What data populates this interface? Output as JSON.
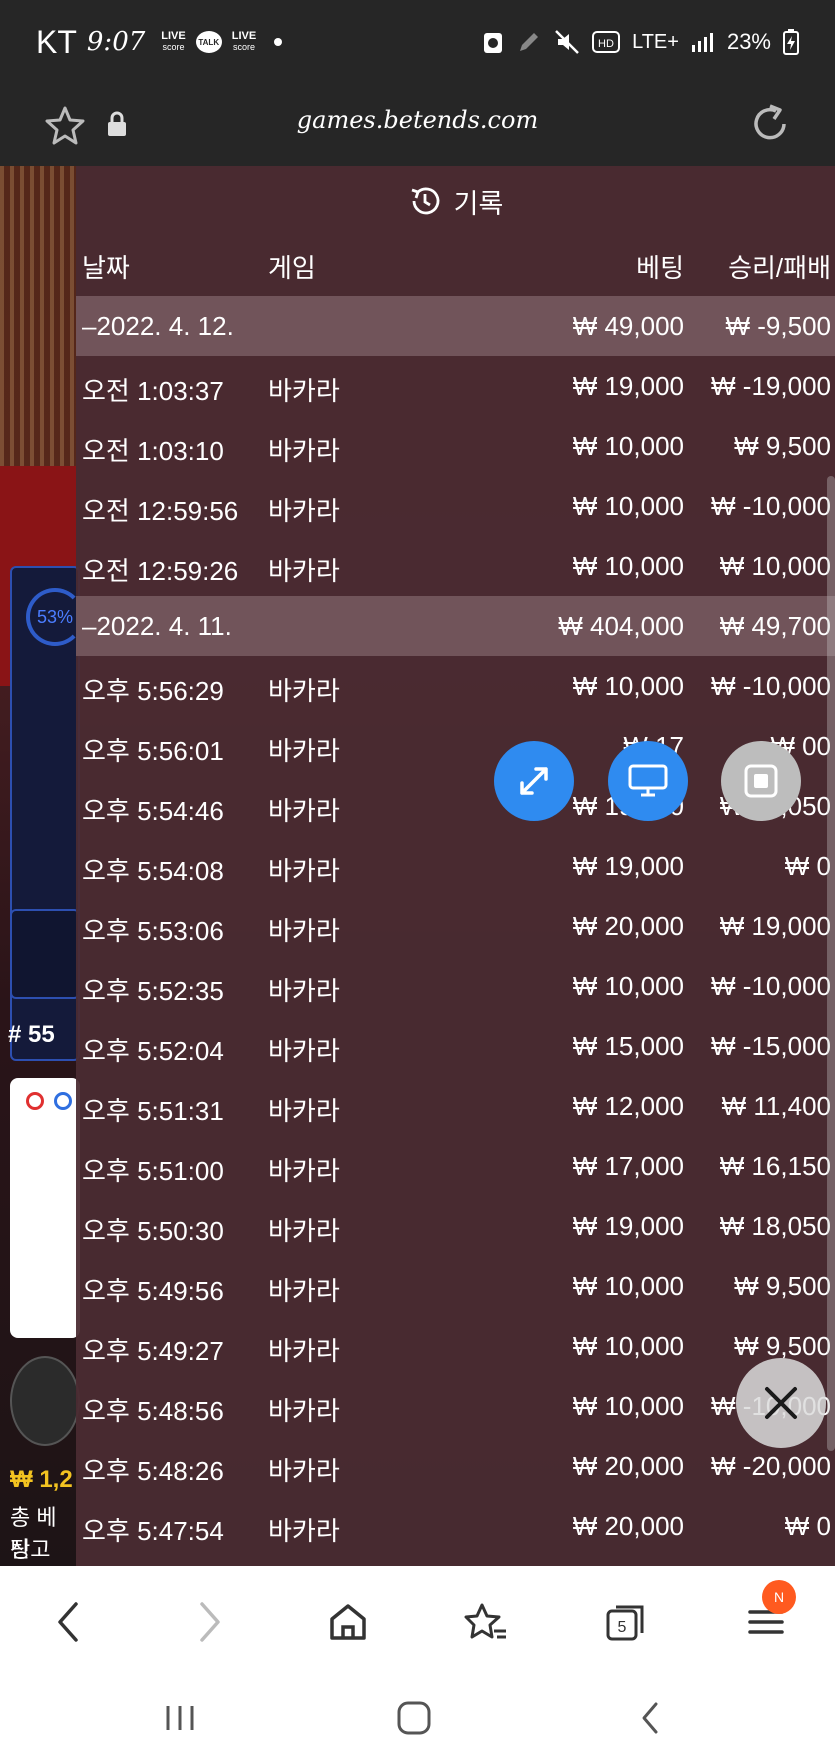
{
  "status_bar": {
    "carrier": "KT",
    "time": "9:07",
    "badge_live_top": "LIVE",
    "badge_live_bottom": "score",
    "talk": "TALK",
    "badge_live2_top": "LIVE",
    "badge_live2_bottom": "score",
    "network": "LTE+",
    "battery": "23%"
  },
  "browser": {
    "url": "games.betends.com"
  },
  "background": {
    "percent": "53%",
    "round": "# 55",
    "currency_line": "₩ 1,2",
    "total_bet_label": "총 베팅",
    "balance_label": "잔고 ₩"
  },
  "history": {
    "title": "기록",
    "columns": {
      "date": "날짜",
      "game": "게임",
      "bet": "베팅",
      "win_loss": "승리/패배"
    },
    "rows": [
      {
        "date": "–2022. 4. 12.",
        "game": "",
        "bet": "₩ 49,000",
        "win": "₩ -9,500",
        "group": true
      },
      {
        "date": "오전 1:03:37",
        "game": "바카라",
        "bet": "₩ 19,000",
        "win": "₩ -19,000"
      },
      {
        "date": "오전 1:03:10",
        "game": "바카라",
        "bet": "₩ 10,000",
        "win": "₩ 9,500"
      },
      {
        "date": "오전 12:59:56",
        "game": "바카라",
        "bet": "₩ 10,000",
        "win": "₩ -10,000"
      },
      {
        "date": "오전 12:59:26",
        "game": "바카라",
        "bet": "₩ 10,000",
        "win": "₩ 10,000"
      },
      {
        "date": "–2022. 4. 11.",
        "game": "",
        "bet": "₩ 404,000",
        "win": "₩ 49,700",
        "group": true
      },
      {
        "date": "오후 5:56:29",
        "game": "바카라",
        "bet": "₩ 10,000",
        "win": "₩ -10,000"
      },
      {
        "date": "오후 5:56:01",
        "game": "바카라",
        "bet": "₩ 17",
        "win": "₩ 00"
      },
      {
        "date": "오후 5:54:46",
        "game": "바카라",
        "bet": "₩ 19,000",
        "win": "₩ 18,050"
      },
      {
        "date": "오후 5:54:08",
        "game": "바카라",
        "bet": "₩ 19,000",
        "win": "₩ 0"
      },
      {
        "date": "오후 5:53:06",
        "game": "바카라",
        "bet": "₩ 20,000",
        "win": "₩ 19,000"
      },
      {
        "date": "오후 5:52:35",
        "game": "바카라",
        "bet": "₩ 10,000",
        "win": "₩ -10,000"
      },
      {
        "date": "오후 5:52:04",
        "game": "바카라",
        "bet": "₩ 15,000",
        "win": "₩ -15,000"
      },
      {
        "date": "오후 5:51:31",
        "game": "바카라",
        "bet": "₩ 12,000",
        "win": "₩ 11,400"
      },
      {
        "date": "오후 5:51:00",
        "game": "바카라",
        "bet": "₩ 17,000",
        "win": "₩ 16,150"
      },
      {
        "date": "오후 5:50:30",
        "game": "바카라",
        "bet": "₩ 19,000",
        "win": "₩ 18,050"
      },
      {
        "date": "오후 5:49:56",
        "game": "바카라",
        "bet": "₩ 10,000",
        "win": "₩ 9,500"
      },
      {
        "date": "오후 5:49:27",
        "game": "바카라",
        "bet": "₩ 10,000",
        "win": "₩ 9,500"
      },
      {
        "date": "오후 5:48:56",
        "game": "바카라",
        "bet": "₩ 10,000",
        "win": "₩ -10,000"
      },
      {
        "date": "오후 5:48:26",
        "game": "바카라",
        "bet": "₩ 20,000",
        "win": "₩ -20,000"
      },
      {
        "date": "오후 5:47:54",
        "game": "바카라",
        "bet": "₩ 20,000",
        "win": "₩ 0"
      }
    ]
  },
  "bottom_nav": {
    "tabs_count": "5",
    "menu_badge": "N"
  },
  "colors": {
    "panel_bg": "#4a2c32",
    "fab_blue": "#2f8bf0",
    "badge_orange": "#ff5a1f"
  }
}
